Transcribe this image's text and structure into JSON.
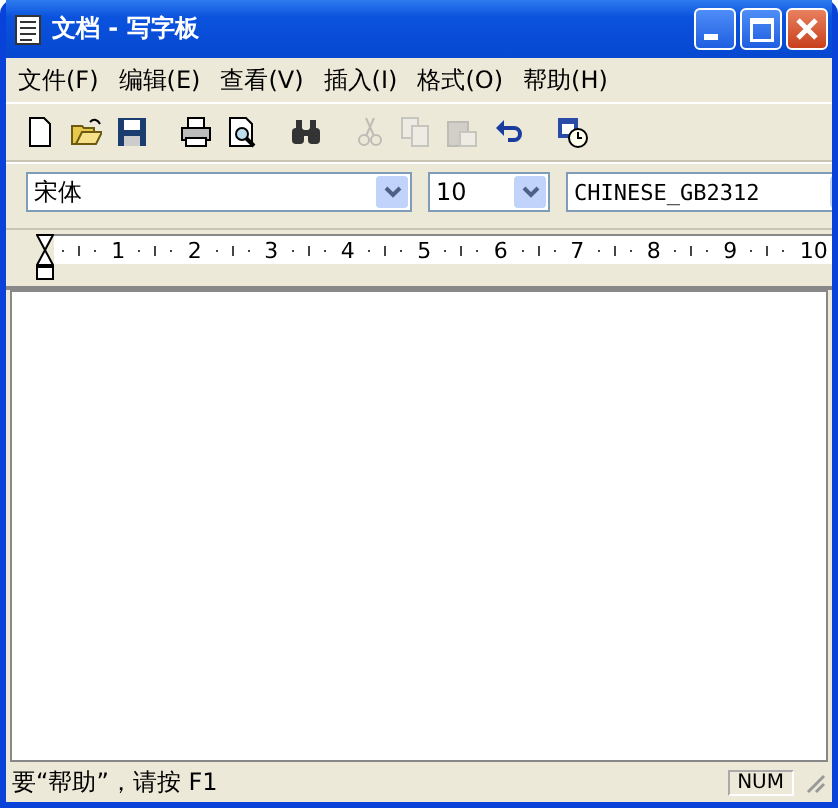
{
  "window": {
    "title": "文档 - 写字板"
  },
  "menu": [
    "文件(F)",
    "编辑(E)",
    "查看(V)",
    "插入(I)",
    "格式(O)",
    "帮助(H)"
  ],
  "toolbar": [
    {
      "kind": "new",
      "disabled": false
    },
    {
      "kind": "open",
      "disabled": false
    },
    {
      "kind": "save",
      "disabled": false
    },
    {
      "kind": "sep"
    },
    {
      "kind": "print",
      "disabled": false
    },
    {
      "kind": "preview",
      "disabled": false
    },
    {
      "kind": "sep"
    },
    {
      "kind": "find",
      "disabled": false
    },
    {
      "kind": "sep"
    },
    {
      "kind": "cut",
      "disabled": true
    },
    {
      "kind": "copy",
      "disabled": true
    },
    {
      "kind": "paste",
      "disabled": true
    },
    {
      "kind": "undo",
      "disabled": false
    },
    {
      "kind": "sep"
    },
    {
      "kind": "datetime",
      "disabled": false
    }
  ],
  "format_bar": {
    "font": "宋体",
    "size": "10",
    "script": "CHINESE_GB2312"
  },
  "ruler": {
    "labels": [
      "1",
      "2",
      "3",
      "4",
      "5",
      "6",
      "7",
      "8",
      "9",
      "10"
    ]
  },
  "status_bar": {
    "message": "要“帮助”，请按 F1",
    "num": "NUM"
  }
}
